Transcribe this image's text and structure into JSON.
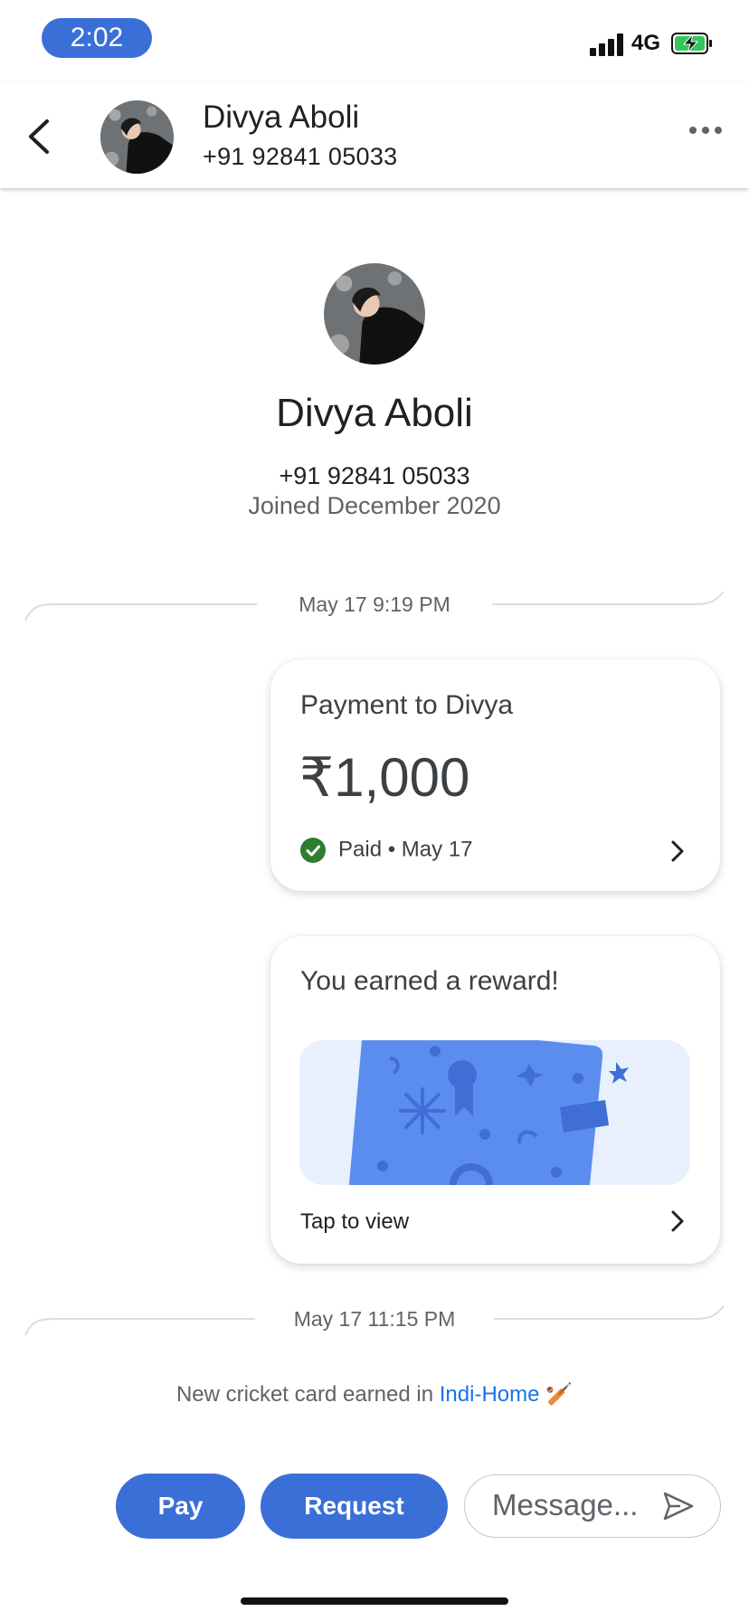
{
  "status_bar": {
    "time": "2:02",
    "network": "4G",
    "icons": [
      "signal-icon",
      "battery-charging-icon"
    ]
  },
  "header": {
    "name": "Divya Aboli",
    "phone": "+91 92841 05033",
    "icons": [
      "back-arrow-icon",
      "avatar",
      "more-horizontal-icon"
    ]
  },
  "profile": {
    "name": "Divya Aboli",
    "phone": "+91 92841 05033",
    "joined": "Joined December 2020"
  },
  "timeline": [
    {
      "timestamp": "May 17 9:19 PM"
    },
    {
      "timestamp": "May 17 11:15 PM"
    }
  ],
  "payment_card": {
    "title": "Payment to Divya",
    "amount": "₹1,000",
    "status": "Paid • May 17",
    "status_color": "#2e7d32"
  },
  "reward_card": {
    "title": "You earned a reward!",
    "action": "Tap to view"
  },
  "system_message": {
    "text": "New cricket card earned in ",
    "link": "Indi-Home",
    "emoji": "🏏"
  },
  "bottom_bar": {
    "pay_label": "Pay",
    "request_label": "Request",
    "message_placeholder": "Message..."
  },
  "colors": {
    "accent": "#3b6fd8",
    "link": "#1a73e8",
    "reward_bg": "#e8effd",
    "reward_card": "#5b8def"
  }
}
